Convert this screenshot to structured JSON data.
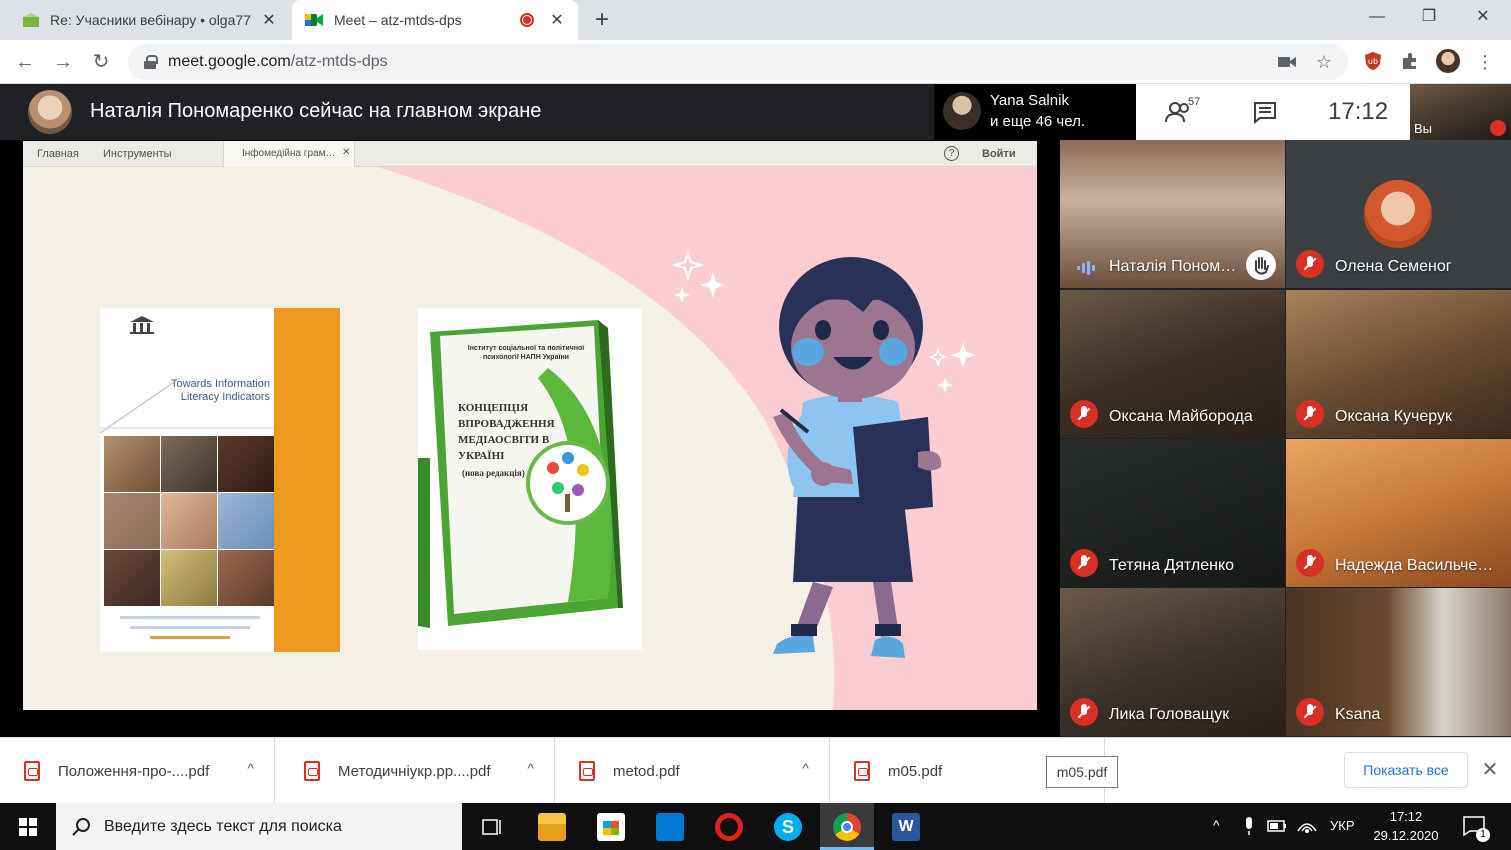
{
  "browser": {
    "tabs": [
      {
        "title": "Re: Учасники вебінару • olga77",
        "close": "✕"
      },
      {
        "title": "Meet – atz-mtds-dps",
        "close": "✕"
      }
    ],
    "new_tab": "+",
    "window": {
      "minimize": "—",
      "restore": "❐",
      "close": "✕"
    },
    "url_domain": "meet.google.com",
    "url_path": "/atz-mtds-dps"
  },
  "meet": {
    "presenting_title": "Наталія Пономаренко сейчас на главном экране",
    "active_speaker": {
      "name": "Yana Salnik",
      "more": "и еще 46 чел."
    },
    "people_count": "57",
    "time": "17:12",
    "self_label": "Вы",
    "participants": [
      {
        "name": "Наталія Поном…",
        "status": "speaking",
        "hand": true
      },
      {
        "name": "Олена Семеног",
        "status": "muted"
      },
      {
        "name": "Оксана Майборода",
        "status": "muted"
      },
      {
        "name": "Оксана Кучерук",
        "status": "muted"
      },
      {
        "name": "Тетяна Дятленко",
        "status": "muted"
      },
      {
        "name": "Надежда Васильче…",
        "status": "muted"
      },
      {
        "name": "Лика Головащук",
        "status": "muted"
      },
      {
        "name": "Ksana",
        "status": "muted"
      }
    ]
  },
  "slide": {
    "nav": {
      "home": "Главная",
      "tools": "Инструменты",
      "doc_tab": "Інфомедійна грам…",
      "doc_close": "✕",
      "help": "?",
      "login": "Войти"
    },
    "book1": {
      "title": "Towards Information Literacy Indicators"
    },
    "book2": {
      "header": "Інститут соціальної та політичної психології НАПН України",
      "title": "КОНЦЕПЦІЯ ВПРОВАДЖЕННЯ МЕДІАОСВІТИ В УКРАЇНІ",
      "subtitle": "(нова редакція)"
    }
  },
  "downloads": {
    "items": [
      {
        "name": "Положення-про-....pdf"
      },
      {
        "name": "Методичніукр.pp....pdf"
      },
      {
        "name": "metod.pdf"
      },
      {
        "name": "m05.pdf"
      }
    ],
    "chevron": "^",
    "tooltip": "m05.pdf",
    "show_all": "Показать все",
    "close": "✕"
  },
  "taskbar": {
    "search_placeholder": "Введите здесь текст для поиска",
    "lang": "УКР",
    "time": "17:12",
    "date": "29.12.2020",
    "notifications": "1"
  },
  "colors": {
    "accent": "#1a73e8",
    "muted_red": "#d93025",
    "meet_bg": "#202124",
    "slide_pink": "#f9cdd2",
    "book_orange": "#ee9a21"
  }
}
